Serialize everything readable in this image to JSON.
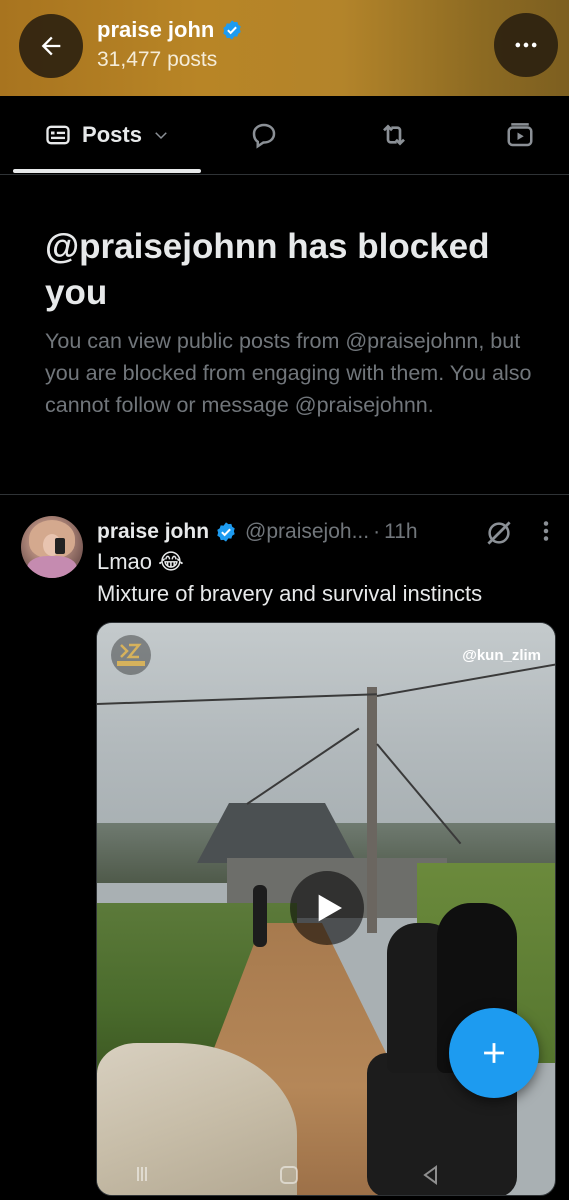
{
  "header": {
    "name": "praise john",
    "post_count": "31,477 posts",
    "back_icon": "arrow-left-icon",
    "more_icon": "more-horizontal-icon",
    "verified_color": "#1d9bf0"
  },
  "tabs": {
    "posts_label": "Posts",
    "items": [
      "posts-icon",
      "replies-icon",
      "reposts-icon",
      "media-icon"
    ]
  },
  "blocked": {
    "title": "@praisejohnn has blocked you",
    "description": "You can view public posts from @praisejohnn, but you are blocked from engaging with them. You also cannot follow or message @praisejohnn."
  },
  "post": {
    "name": "praise john",
    "handle": "@praisejoh...",
    "dot": "·",
    "time": "11h",
    "line1": "Lmao 😂",
    "line2": "Mixture of bravery and survival instincts",
    "media": {
      "watermark_handle": "@kun_zlim",
      "play_icon": "play-icon"
    }
  },
  "colors": {
    "background": "#000000",
    "text": "#e7e9ea",
    "muted": "#71767b",
    "accent": "#1d9bf0",
    "header_gold": "#b88526"
  }
}
